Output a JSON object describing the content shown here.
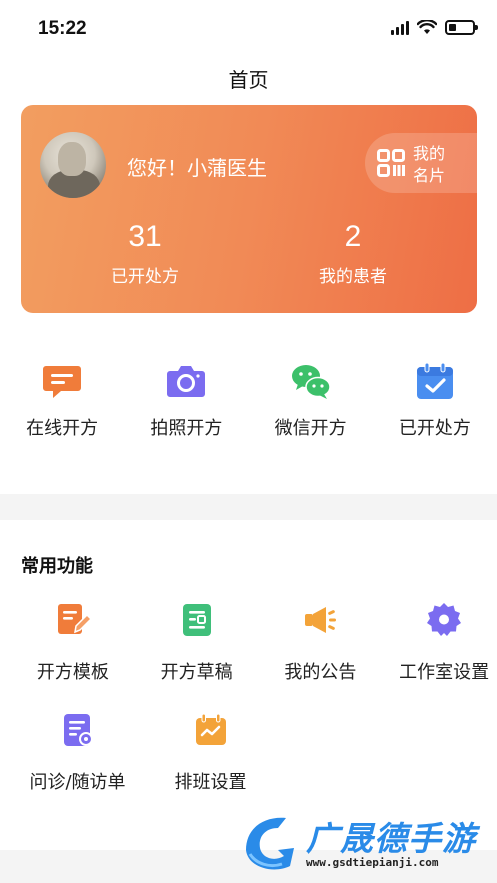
{
  "status_bar": {
    "time": "15:22",
    "battery_level": 0.3
  },
  "nav": {
    "title": "首页"
  },
  "profile_card": {
    "greeting": "您好！小蒲医生",
    "card_button": {
      "line1": "我的",
      "line2": "名片"
    },
    "stats": [
      {
        "value": "31",
        "label": "已开处方"
      },
      {
        "value": "2",
        "label": "我的患者"
      }
    ]
  },
  "quick_actions": [
    {
      "label": "在线开方",
      "icon": "chat-message-icon",
      "color": "#f07c3a"
    },
    {
      "label": "拍照开方",
      "icon": "camera-icon",
      "color": "#7b6cf0"
    },
    {
      "label": "微信开方",
      "icon": "wechat-icon",
      "color": "#3cc06a"
    },
    {
      "label": "已开处方",
      "icon": "calendar-check-icon",
      "color": "#4a8ef0"
    }
  ],
  "common": {
    "title": "常用功能",
    "items": [
      {
        "label": "开方模板",
        "icon": "edit-document-icon",
        "color": "#f07c3a"
      },
      {
        "label": "开方草稿",
        "icon": "draft-icon",
        "color": "#3fbf7a"
      },
      {
        "label": "我的公告",
        "icon": "megaphone-icon",
        "color": "#f3a339"
      },
      {
        "label": "工作室设置",
        "icon": "gear-icon",
        "color": "#7b6cf0"
      },
      {
        "label": "问诊/随访单",
        "icon": "form-settings-icon",
        "color": "#7b6cf0"
      },
      {
        "label": "排班设置",
        "icon": "schedule-icon",
        "color": "#f3a339"
      }
    ]
  },
  "watermark": {
    "text": "广晟德手游",
    "url": "www.gsdtiepianji.com"
  }
}
